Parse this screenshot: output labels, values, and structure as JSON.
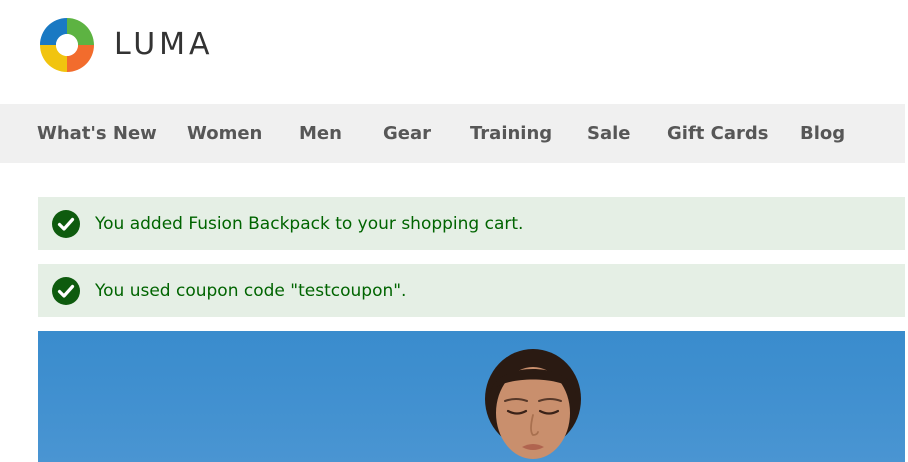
{
  "brand": {
    "name": "LUMA",
    "logo_icon": "luma-logo-icon",
    "colors": {
      "blue": "#1979c3",
      "green": "#5db342",
      "orange": "#f26c2d",
      "yellow": "#f1c40f"
    }
  },
  "nav": {
    "items": [
      {
        "label": "What's New"
      },
      {
        "label": "Women"
      },
      {
        "label": "Men"
      },
      {
        "label": "Gear"
      },
      {
        "label": "Training"
      },
      {
        "label": "Sale"
      },
      {
        "label": "Gift Cards"
      },
      {
        "label": "Blog"
      }
    ]
  },
  "messages": [
    {
      "type": "success",
      "icon": "check-circle-icon",
      "text": "You added Fusion Backpack to your shopping cart."
    },
    {
      "type": "success",
      "icon": "check-circle-icon",
      "text": "You used coupon code \"testcoupon\"."
    }
  ],
  "hero": {
    "image": "woman-meditating-banner"
  },
  "colors": {
    "nav_bg": "#f0f0f0",
    "nav_text": "#575757",
    "success_bg": "#e5efe5",
    "success_text": "#006400",
    "hero_sky": "#3f8fcf"
  }
}
